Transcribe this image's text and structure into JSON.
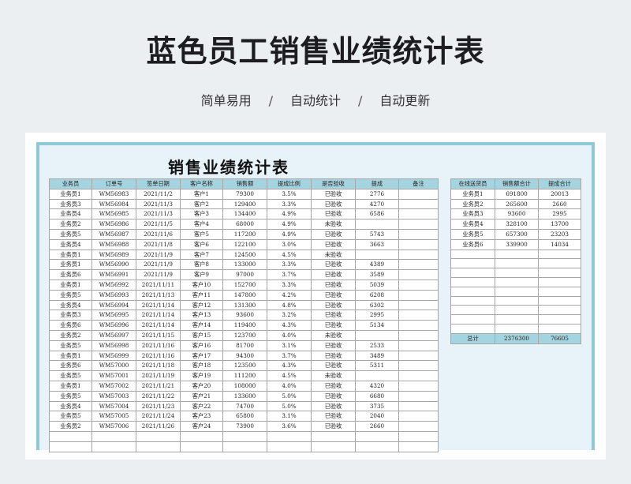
{
  "page": {
    "title": "蓝色员工销售业绩统计表",
    "tags": [
      "简单易用",
      "自动统计",
      "自动更新"
    ],
    "separator": "/"
  },
  "sheet": {
    "title": "销售业绩统计表",
    "columns": [
      "业务员",
      "订单号",
      "签单日期",
      "客户名称",
      "销售额",
      "提成比例",
      "是否验收",
      "提成",
      "备注"
    ],
    "rows": [
      [
        "业务员1",
        "WM56983",
        "2021/11/2",
        "客户1",
        "79300",
        "3.5%",
        "已验收",
        "2776",
        ""
      ],
      [
        "业务员3",
        "WM56984",
        "2021/11/3",
        "客户2",
        "129400",
        "3.3%",
        "已验收",
        "4270",
        ""
      ],
      [
        "业务员4",
        "WM56985",
        "2021/11/3",
        "客户3",
        "134400",
        "4.9%",
        "已验收",
        "6586",
        ""
      ],
      [
        "业务员2",
        "WM56986",
        "2021/11/5",
        "客户4",
        "68000",
        "4.9%",
        "未验收",
        "",
        ""
      ],
      [
        "业务员5",
        "WM56987",
        "2021/11/6",
        "客户5",
        "117200",
        "4.9%",
        "已验收",
        "5743",
        ""
      ],
      [
        "业务员4",
        "WM56988",
        "2021/11/8",
        "客户6",
        "122100",
        "3.0%",
        "已验收",
        "3663",
        ""
      ],
      [
        "业务员1",
        "WM56989",
        "2021/11/9",
        "客户7",
        "124500",
        "4.5%",
        "未验收",
        "",
        ""
      ],
      [
        "业务员1",
        "WM56990",
        "2021/11/9",
        "客户8",
        "133000",
        "3.3%",
        "已验收",
        "4389",
        ""
      ],
      [
        "业务员6",
        "WM56991",
        "2021/11/9",
        "客户9",
        "97000",
        "3.7%",
        "已验收",
        "3589",
        ""
      ],
      [
        "业务员1",
        "WM56992",
        "2021/11/11",
        "客户10",
        "152700",
        "3.3%",
        "已验收",
        "5039",
        ""
      ],
      [
        "业务员5",
        "WM56993",
        "2021/11/13",
        "客户11",
        "147800",
        "4.2%",
        "已验收",
        "6208",
        ""
      ],
      [
        "业务员4",
        "WM56994",
        "2021/11/14",
        "客户12",
        "131300",
        "4.8%",
        "已验收",
        "6302",
        ""
      ],
      [
        "业务员3",
        "WM56995",
        "2021/11/14",
        "客户13",
        "93600",
        "3.2%",
        "已验收",
        "2995",
        ""
      ],
      [
        "业务员6",
        "WM56996",
        "2021/11/14",
        "客户14",
        "119400",
        "4.3%",
        "已验收",
        "5134",
        ""
      ],
      [
        "业务员2",
        "WM56997",
        "2021/11/15",
        "客户15",
        "123700",
        "4.0%",
        "未验收",
        "",
        ""
      ],
      [
        "业务员5",
        "WM56998",
        "2021/11/16",
        "客户16",
        "81700",
        "3.1%",
        "已验收",
        "2533",
        ""
      ],
      [
        "业务员1",
        "WM56999",
        "2021/11/16",
        "客户17",
        "94300",
        "3.7%",
        "已验收",
        "3489",
        ""
      ],
      [
        "业务员6",
        "WM57000",
        "2021/11/18",
        "客户18",
        "123500",
        "4.3%",
        "已验收",
        "5311",
        ""
      ],
      [
        "业务员5",
        "WM57001",
        "2021/11/19",
        "客户19",
        "111200",
        "4.5%",
        "未验收",
        "",
        ""
      ],
      [
        "业务员1",
        "WM57002",
        "2021/11/21",
        "客户20",
        "108000",
        "4.0%",
        "已验收",
        "4320",
        ""
      ],
      [
        "业务员5",
        "WM57003",
        "2021/11/22",
        "客户21",
        "133600",
        "5.0%",
        "已验收",
        "6680",
        ""
      ],
      [
        "业务员4",
        "WM57004",
        "2021/11/23",
        "客户22",
        "74700",
        "5.0%",
        "已验收",
        "3735",
        ""
      ],
      [
        "业务员5",
        "WM57005",
        "2021/11/24",
        "客户23",
        "65800",
        "3.1%",
        "已验收",
        "2040",
        ""
      ],
      [
        "业务员2",
        "WM57006",
        "2021/11/26",
        "客户24",
        "73900",
        "3.6%",
        "已验收",
        "2660",
        ""
      ],
      [
        "",
        "",
        "",
        "",
        "",
        "",
        "",
        "",
        ""
      ],
      [
        "",
        "",
        "",
        "",
        "",
        "",
        "",
        "",
        ""
      ]
    ]
  },
  "summary": {
    "columns": [
      "在线送货员",
      "销售额合计",
      "提成合计"
    ],
    "rows": [
      [
        "业务员1",
        "691800",
        "20013"
      ],
      [
        "业务员2",
        "265600",
        "2660"
      ],
      [
        "业务员3",
        "93600",
        "2995"
      ],
      [
        "业务员4",
        "328100",
        "13700"
      ],
      [
        "业务员5",
        "657300",
        "23203"
      ],
      [
        "业务员6",
        "339900",
        "14034"
      ]
    ],
    "empty_rows": 9,
    "total": [
      "总计",
      "2376300",
      "76605"
    ]
  }
}
